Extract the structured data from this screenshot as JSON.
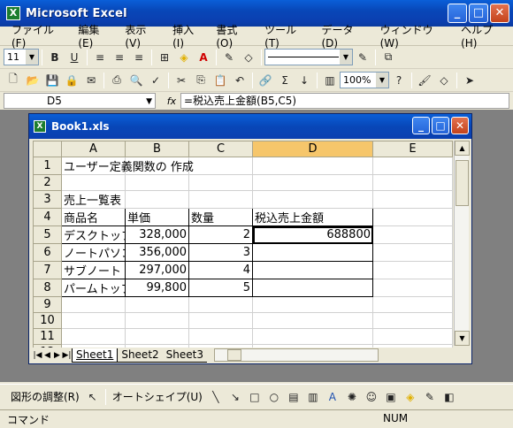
{
  "window": {
    "title": "Microsoft Excel"
  },
  "menu": [
    "ファイル(F)",
    "編集(E)",
    "表示(V)",
    "挿入(I)",
    "書式(O)",
    "ツール(T)",
    "データ(D)",
    "ウィンドウ(W)",
    "ヘルプ(H)"
  ],
  "format_toolbar": {
    "font_size": "11"
  },
  "std_toolbar": {
    "zoom": "100%"
  },
  "formula_bar": {
    "cell_ref": "D5",
    "fx_label": "fx",
    "formula": "=税込売上金額(B5,C5)"
  },
  "workbook": {
    "title": "Book1.xls",
    "columns": [
      "A",
      "B",
      "C",
      "D",
      "E"
    ],
    "selected_column": "D",
    "rows": [
      {
        "n": "1",
        "a": "ユーザー定義関数の 作成",
        "b": "",
        "c": "",
        "d": ""
      },
      {
        "n": "2",
        "a": "",
        "b": "",
        "c": "",
        "d": ""
      },
      {
        "n": "3",
        "a": "売上一覧表",
        "b": "",
        "c": "",
        "d": ""
      },
      {
        "n": "4",
        "a": "商品名",
        "b": "単価",
        "c": "数量",
        "d": "税込売上金額"
      },
      {
        "n": "5",
        "a": "デスクトップ",
        "b": "328,000",
        "c": "2",
        "d": "688800"
      },
      {
        "n": "6",
        "a": "ノートパソコ",
        "b": "356,000",
        "c": "3",
        "d": ""
      },
      {
        "n": "7",
        "a": "サブノート",
        "b": "297,000",
        "c": "4",
        "d": ""
      },
      {
        "n": "8",
        "a": "パームトップ",
        "b": "99,800",
        "c": "5",
        "d": ""
      },
      {
        "n": "9",
        "a": "",
        "b": "",
        "c": "",
        "d": ""
      },
      {
        "n": "10",
        "a": "",
        "b": "",
        "c": "",
        "d": ""
      },
      {
        "n": "11",
        "a": "",
        "b": "",
        "c": "",
        "d": ""
      },
      {
        "n": "12",
        "a": "",
        "b": "",
        "c": "",
        "d": ""
      }
    ],
    "sheets": [
      "Sheet1",
      "Sheet2",
      "Sheet3"
    ],
    "active_sheet": "Sheet1"
  },
  "draw_toolbar": {
    "adjust_label": "図形の調整(R)",
    "autoshape_label": "オートシェイプ(U)"
  },
  "status": {
    "left": "コマンド",
    "num": "NUM"
  },
  "colors": {
    "titlebar": "#0847b8",
    "selected_header": "#f6c66b",
    "chrome": "#ece9d8"
  }
}
